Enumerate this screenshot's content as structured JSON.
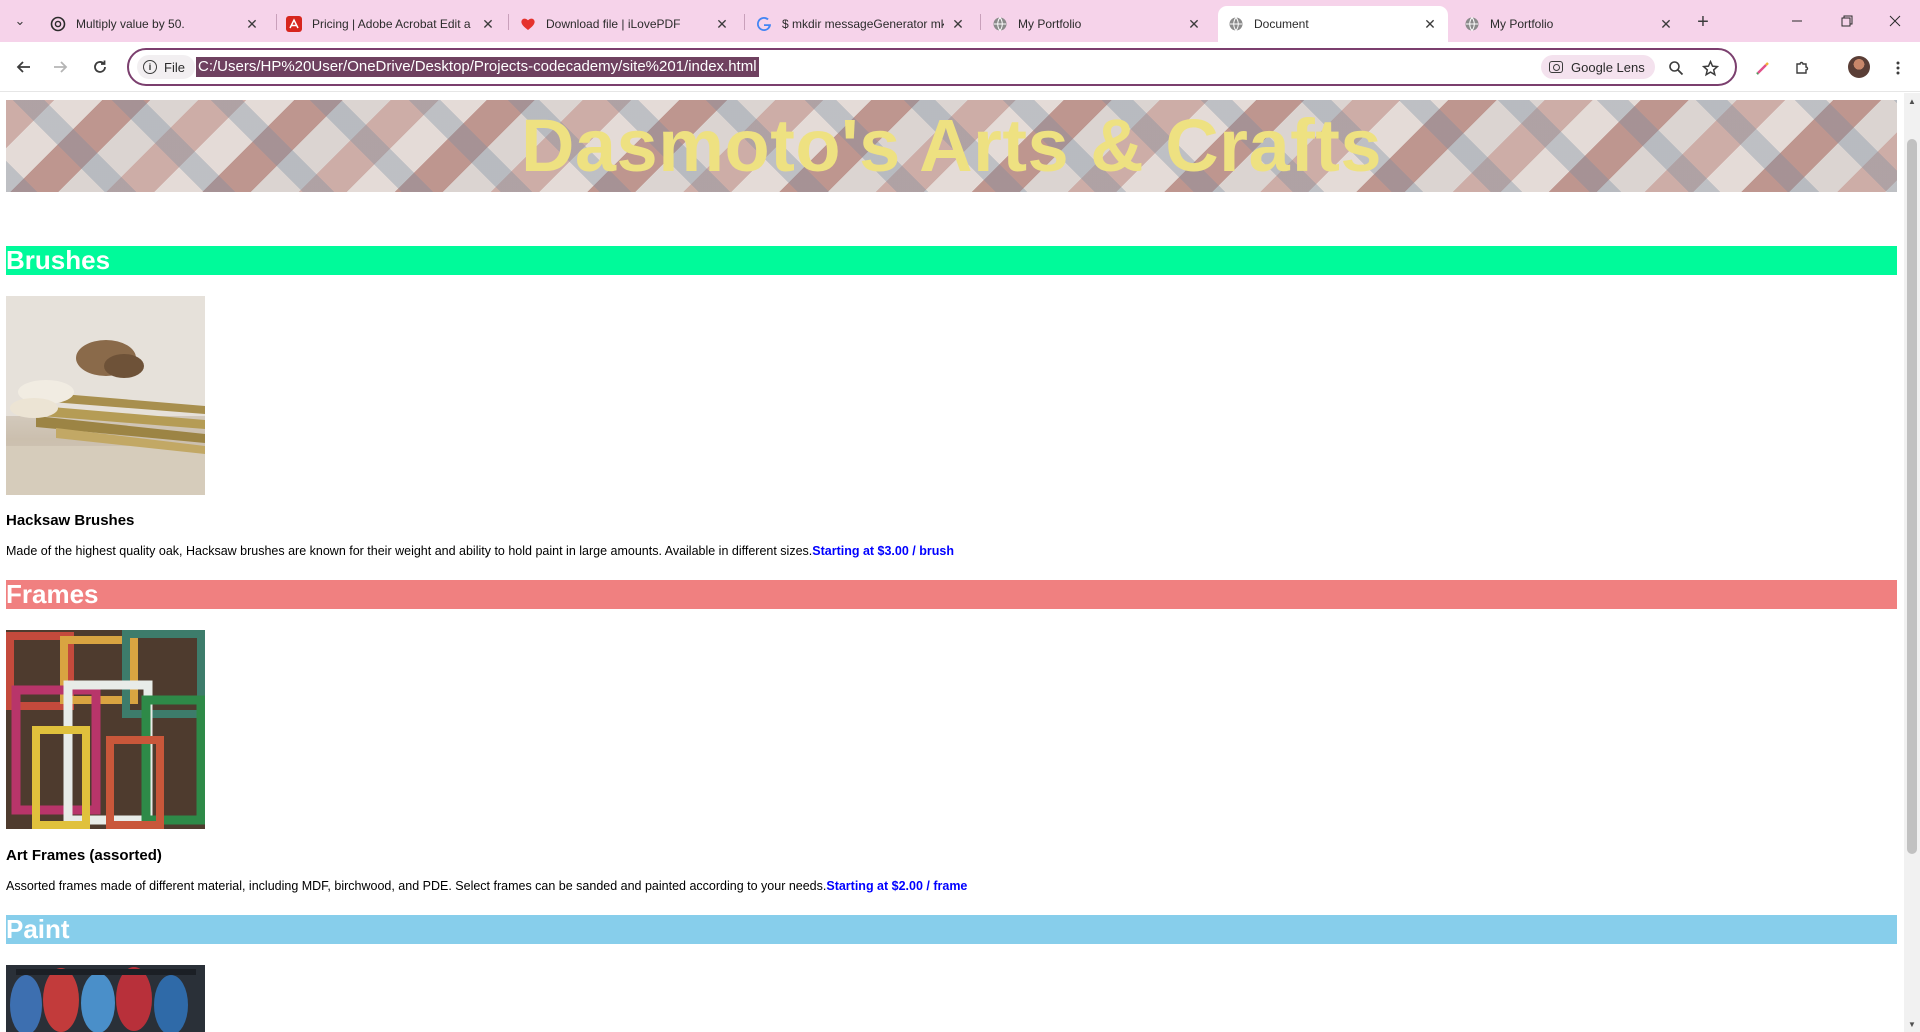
{
  "browser": {
    "tabs": [
      {
        "title": "Multiply value by 50.",
        "icon": "openai-icon",
        "active": false
      },
      {
        "title": "Pricing | Adobe Acrobat Edit a PDF",
        "icon": "acrobat-icon",
        "active": false
      },
      {
        "title": "Download file | iLovePDF",
        "icon": "ilovepdf-heart-icon",
        "active": false
      },
      {
        "title": "$ mkdir messageGenerator mkdir",
        "icon": "google-icon",
        "active": false
      },
      {
        "title": "My Portfolio",
        "icon": "globe-icon",
        "active": false
      },
      {
        "title": "Document",
        "icon": "globe-icon",
        "active": true
      },
      {
        "title": "My Portfolio",
        "icon": "globe-icon",
        "active": false
      }
    ],
    "site_chip_label": "File",
    "url": "C:/Users/HP%20User/OneDrive/Desktop/Projects-codecademy/site%201/index.html",
    "lens_label": "Google Lens",
    "accent_color": "#f6d3ea"
  },
  "page": {
    "banner_title": "Dasmoto's Arts & Crafts",
    "banner_title_color": "#eee181",
    "sections": [
      {
        "heading": "Brushes",
        "heading_bg": "#00fa9a",
        "image_icon": "brushes-photo",
        "item_title": "Hacksaw Brushes",
        "description": "Made of the highest quality oak, Hacksaw brushes are known for their weight and ability to hold paint in large amounts. Available in different sizes.",
        "price": "Starting at $3.00 / brush"
      },
      {
        "heading": "Frames",
        "heading_bg": "#f08080",
        "image_icon": "frames-photo",
        "item_title": "Art Frames (assorted)",
        "description": "Assorted frames made of different material, including MDF, birchwood, and PDE. Select frames can be sanded and painted according to your needs.",
        "price": "Starting at $2.00 / frame"
      },
      {
        "heading": "Paint",
        "heading_bg": "#87ceeb",
        "image_icon": "paint-tubes-photo"
      }
    ],
    "price_color": "#0000ff"
  }
}
